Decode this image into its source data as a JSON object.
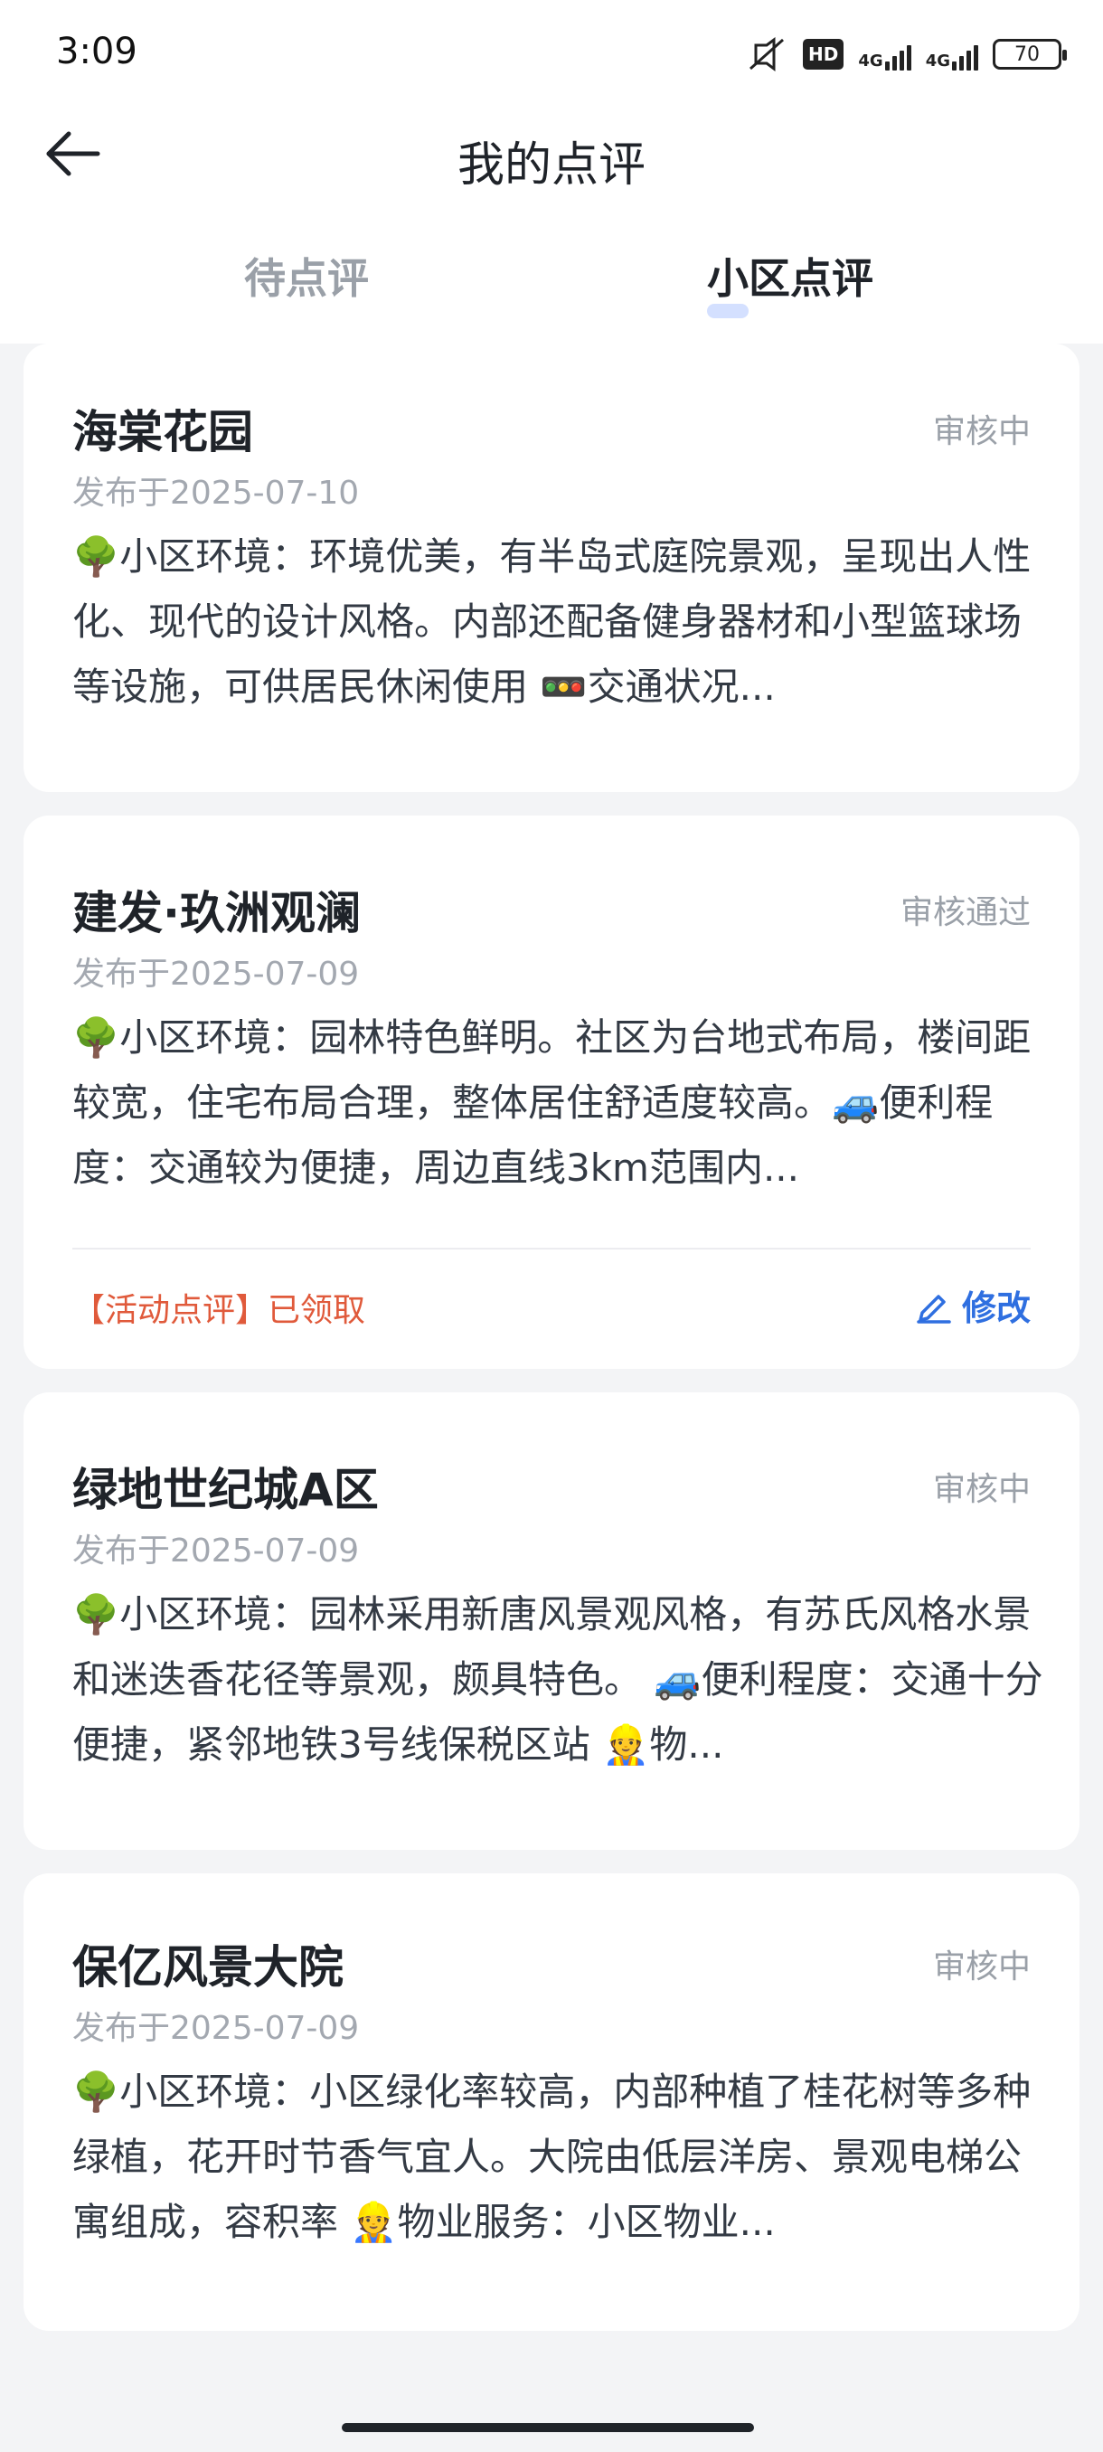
{
  "status_bar": {
    "time": "3:09",
    "hd": "HD",
    "network1": "4G",
    "network2": "4G",
    "battery": "70"
  },
  "header": {
    "title": "我的点评"
  },
  "tabs": [
    {
      "label": "待点评",
      "active": false
    },
    {
      "label": "小区点评",
      "active": true
    }
  ],
  "reviews": [
    {
      "name": "海棠花园",
      "status": "审核中",
      "date": "发布于2025-07-10",
      "content": "🌳小区环境：环境优美，有半岛式庭院景观，呈现出人性化、现代的设计风格。内部还配备健身器材和小型篮球场等设施，可供居民休闲使用 🚥交通状况..."
    },
    {
      "name": "建发·玖洲观澜",
      "status": "审核通过",
      "date": "发布于2025-07-09",
      "content": "🌳小区环境：园林特色鲜明。社区为台地式布局，楼间距较宽，住宅布局合理，整体居住舒适度较高。🚙便利程度：交通较为便捷，周边直线3km范围内...",
      "activity": "【活动点评】已领取",
      "edit": "修改"
    },
    {
      "name": "绿地世纪城A区",
      "status": "审核中",
      "date": "发布于2025-07-09",
      "content": "🌳小区环境：园林采用新唐风景观风格，有苏氏风格水景和迷迭香花径等景观，颇具特色。 🚙便利程度：交通十分便捷，紧邻地铁3号线保税区站 👷物..."
    },
    {
      "name": "保亿风景大院",
      "status": "审核中",
      "date": "发布于2025-07-09",
      "content": "🌳小区环境：小区绿化率较高，内部种植了桂花树等多种绿植，花开时节香气宜人。大院由低层洋房、景观电梯公寓组成，容积率 👷物业服务：小区物业..."
    }
  ],
  "colors": {
    "accent": "#2f6fe0",
    "activity": "#e05a3b",
    "muted": "#9aa0a8",
    "background": "#f3f4f6"
  }
}
